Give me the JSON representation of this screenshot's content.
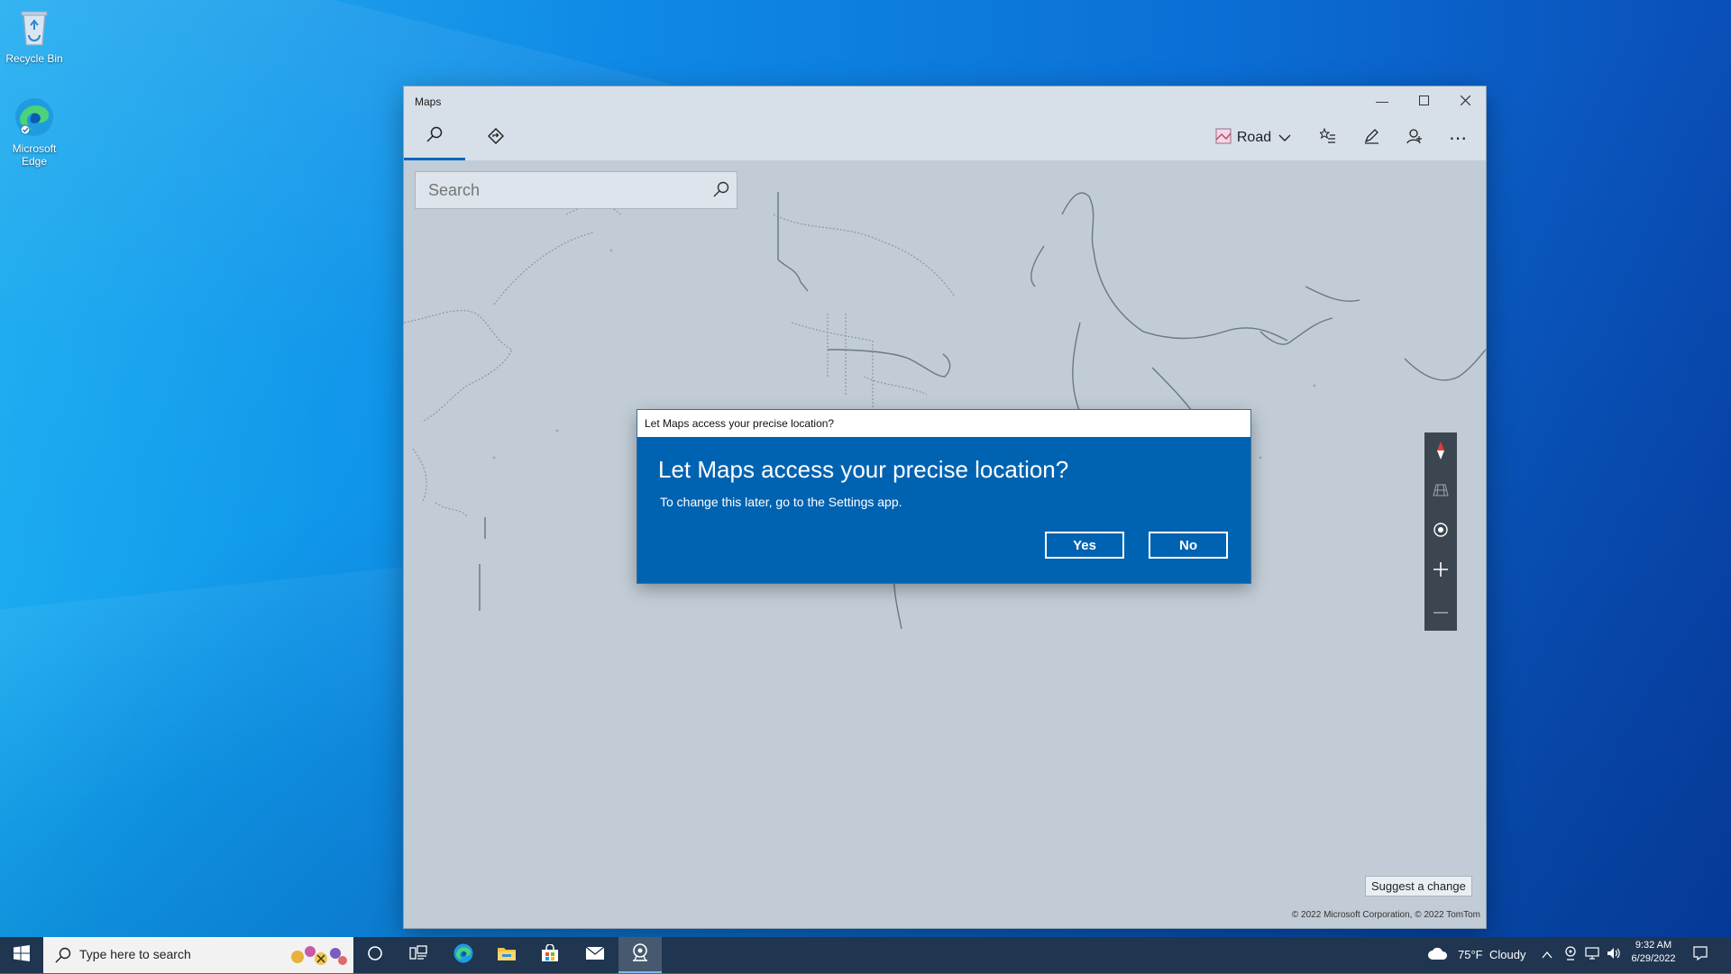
{
  "desktop": {
    "icons": [
      {
        "label": "Recycle Bin"
      },
      {
        "label": "Microsoft Edge"
      }
    ]
  },
  "window": {
    "title": "Maps",
    "controls": {
      "minimize": "minimize-icon",
      "maximize": "maximize-icon",
      "close": "close-icon"
    },
    "toolbar": {
      "tabs": [
        {
          "icon": "search-icon",
          "active": true
        },
        {
          "icon": "directions-icon",
          "active": false
        }
      ],
      "map_style_label": "Road",
      "actions": [
        "favorites-icon",
        "ink-pen-icon",
        "account-icon",
        "more-icon"
      ]
    },
    "search": {
      "placeholder": "Search"
    },
    "suggest_label": "Suggest a change",
    "copyright": "© 2022 Microsoft Corporation, © 2022 TomTom",
    "nav_controls": [
      "compass-icon",
      "tilt-icon",
      "locate-me-icon",
      "zoom-in-icon",
      "zoom-out-icon"
    ]
  },
  "dialog": {
    "title_bar": "Let Maps access your precise location?",
    "heading": "Let Maps access your precise location?",
    "body": "To change this later, go to the Settings app.",
    "yes_label": "Yes",
    "no_label": "No",
    "accent_color": "#0063b1"
  },
  "taskbar": {
    "search_placeholder": "Type here to search",
    "weather_temp": "75°F",
    "weather_condition": "Cloudy",
    "time": "9:32 AM",
    "date": "6/29/2022",
    "apps": [
      "start-icon",
      "cortana-icon",
      "task-view-icon",
      "edge-icon",
      "file-explorer-icon",
      "store-icon",
      "mail-icon",
      "maps-icon"
    ]
  }
}
